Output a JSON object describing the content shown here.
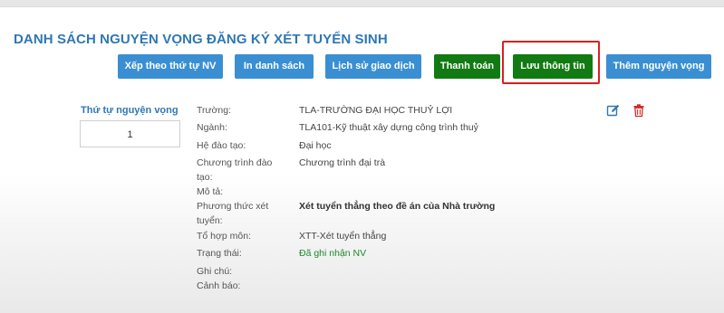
{
  "page": {
    "title": "DANH SÁCH NGUYỆN VỌNG ĐĂNG KÝ XÉT TUYỂN SINH"
  },
  "toolbar": {
    "sort_label": "Xếp theo thứ tự NV",
    "print_label": "In danh sách",
    "history_label": "Lịch sử giao dịch",
    "pay_label": "Thanh toán",
    "save_label": "Lưu thông tin",
    "add_label": "Thêm nguyện vọng"
  },
  "entry": {
    "order_label": "Thứ tự nguyện vọng",
    "order_value": "1",
    "fields": {
      "school_label": "Trường:",
      "school_value": "TLA-TRƯỜNG ĐẠI HỌC THUỶ LỢI",
      "major_label": "Ngành:",
      "major_value": "TLA101-Kỹ thuật xây dựng công trình thuỷ",
      "level_label": "Hệ đào tạo:",
      "level_value": "Đại học",
      "program_label": "Chương trình đào tạo:",
      "program_value": "Chương trình đại trà",
      "desc_label": "Mô tả:",
      "method_label": "Phương thức xét tuyển:",
      "method_value": "Xét tuyển thẳng theo đề án của Nhà trường",
      "combo_label": "Tổ hợp môn:",
      "combo_value": "XTT-Xét tuyển thẳng",
      "status_label": "Trạng thái:",
      "status_value": "Đã ghi nhận NV",
      "note_label": "Ghi chú:",
      "warning_label": "Cảnh báo:"
    }
  },
  "icons": {
    "edit": "edit-icon",
    "delete": "trash-icon"
  },
  "colors": {
    "title_blue": "#2f77b3",
    "button_blue": "#3a8fd2",
    "button_green": "#127a12",
    "highlight_red": "#d81f1f",
    "status_green": "#1e8a2a"
  }
}
